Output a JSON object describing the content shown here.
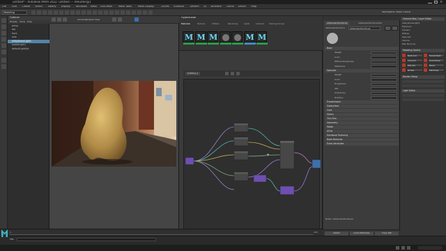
{
  "window": {
    "title": "untitled* - Autodesk MAYA 2022: untitled   ---   mHunter@1"
  },
  "menubar": {
    "items": [
      "File",
      "Edit",
      "Create",
      "Select",
      "Modify",
      "Display",
      "Windows",
      "Mesh",
      "Edit Mesh",
      "Mesh Tools",
      "Mesh Display",
      "Curves",
      "Surfaces",
      "Deform",
      "UV",
      "Generate",
      "Cache",
      "Arnold",
      "Help"
    ]
  },
  "statusline": {
    "mode": "Modeling",
    "workspace": "Workspace: Maya Classic"
  },
  "outliner": {
    "title": "Outliner",
    "menus": [
      "Display",
      "Show",
      "Help"
    ],
    "items": [
      {
        "label": "persp",
        "selected": false
      },
      {
        "label": "top",
        "selected": false
      },
      {
        "label": "front",
        "selected": false
      },
      {
        "label": "side",
        "selected": false
      },
      {
        "label": "aiSkyDomeLight1",
        "selected": true
      },
      {
        "label": "aiAreaLight1",
        "selected": false
      },
      {
        "label": "defaultLightSet",
        "selected": false
      }
    ]
  },
  "viewport": {
    "renderer": "Arnold Renderer View"
  },
  "hypershade": {
    "title": "Hypershade",
    "browser_tabs": [
      "Materials",
      "Textures",
      "Utilities",
      "Rendering",
      "Lights",
      "Cameras",
      "Shading Groups"
    ],
    "swatches": [
      {
        "letter": "M",
        "selected": false
      },
      {
        "letter": "M",
        "selected": false
      },
      {
        "letter": "M",
        "selected": false
      },
      {
        "letter": "",
        "selected": false
      },
      {
        "letter": "",
        "selected": false
      },
      {
        "letter": "M",
        "selected": true
      },
      {
        "letter": "M",
        "selected": false
      }
    ],
    "graph_tab": "Untitled_1",
    "nodes": [
      "file1",
      "file2",
      "file3",
      "place2dTexture",
      "aiStandardSurface1",
      "displacementShader1",
      "aiImage1"
    ]
  },
  "attribute_editor": {
    "tabs": [
      "aiStandardSurface1",
      "aiStandardSurface1SG"
    ],
    "node_label": "aiStandardSurface:",
    "node_name": "aiStandardSurface1",
    "sections": [
      "Base",
      "Specular",
      "Transmission",
      "Subsurface",
      "Coat",
      "Sheen",
      "Thin Film",
      "Geometry",
      "Matte",
      "AOVs",
      "Hardware Texturing",
      "Node Behavior",
      "Extra Attributes"
    ],
    "rows": [
      "Weight",
      "Color",
      "Diffuse Roughness",
      "Metalness",
      "Weight",
      "Color",
      "Roughness",
      "IOR",
      "Anisotropy",
      "Rotation"
    ],
    "notes_label": "Notes: aiStandardSurface1",
    "buttons": [
      "Select",
      "Load Attributes",
      "Copy Tab"
    ]
  },
  "right_panel": {
    "title": "Channel Box / Layer Editor",
    "items": [
      "aiSkyDomeLight1",
      "Exposure",
      "Camera",
      "Diffuse",
      "Specular",
      "Volume",
      "Max Bounces"
    ],
    "sections": [
      "Modeling Toolkit",
      "Render Setup",
      "Light Editor"
    ],
    "buttons": [
      "Multi-Cut",
      "Target Weld",
      "Connect",
      "Quad Draw",
      "Extrude",
      "Bevel",
      "Bridge",
      "Edit Edge"
    ]
  },
  "timeline": {
    "frame_start": "1",
    "frame_end": "120"
  },
  "cmdline": {
    "label": "MEL"
  }
}
